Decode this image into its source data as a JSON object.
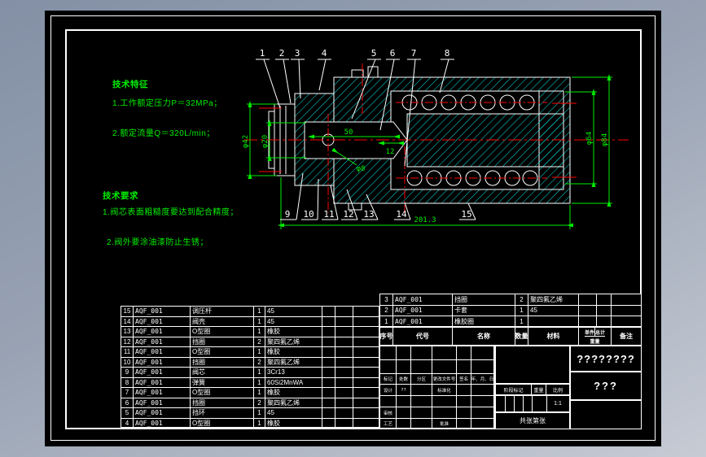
{
  "drawing": {
    "notes": {
      "features_title": "技术特征",
      "features": [
        "1.工作额定压力P＝32MPa；",
        "2.额定流量Q＝320L/min；"
      ],
      "requirements_title": "技术要求",
      "requirements": [
        "1.阀芯表面粗糙度要达到配合精度；",
        "2.阀外要涂油漆防止生锈；"
      ]
    },
    "dims": {
      "phi42": "φ42",
      "phi20": "φ20",
      "len50": "50",
      "len12": "12",
      "phi8": "φ8",
      "len201": "201.3",
      "phi64": "φ64",
      "phi84": "φ84"
    },
    "callouts_top": [
      "1",
      "2",
      "3",
      "4",
      "5",
      "6",
      "7",
      "8"
    ],
    "callouts_bottom": [
      "9",
      "10",
      "11",
      "12",
      "13",
      "14",
      "15"
    ],
    "colors": {
      "outline": "#ffffff",
      "hatch": "#00e5e5",
      "dimension": "#00ee00",
      "centerline": "#ff0000"
    }
  },
  "bom": {
    "headers": {
      "seq": "序号",
      "code": "代号",
      "name": "名称",
      "qty": "数量",
      "material": "材料",
      "unit": "单件",
      "total": "总计",
      "weight": "重量",
      "remark": "备注"
    },
    "left_rows": [
      [
        "15",
        "AQF_001",
        "调压杆",
        "1",
        "45",
        "",
        "",
        ""
      ],
      [
        "14",
        "AQF_001",
        "阀壳",
        "1",
        "45",
        "",
        "",
        ""
      ],
      [
        "13",
        "AQF_001",
        "O型圈",
        "1",
        "橡胶",
        "",
        "",
        ""
      ],
      [
        "12",
        "AQF_001",
        "挡圈",
        "2",
        "聚四氟乙烯",
        "",
        "",
        ""
      ],
      [
        "11",
        "AQF_001",
        "O型圈",
        "1",
        "橡胶",
        "",
        "",
        ""
      ],
      [
        "10",
        "AQF_001",
        "挡圈",
        "2",
        "聚四氟乙烯",
        "",
        "",
        ""
      ],
      [
        "9",
        "AQF_001",
        "阀芯",
        "1",
        "3Cr13",
        "",
        "",
        ""
      ],
      [
        "8",
        "AQF_001",
        "弹簧",
        "1",
        "60Si2MnWA",
        "",
        "",
        ""
      ],
      [
        "7",
        "AQF_001",
        "O型圈",
        "1",
        "橡胶",
        "",
        "",
        ""
      ],
      [
        "6",
        "AQF_001",
        "挡圈",
        "2",
        "聚四氟乙烯",
        "",
        "",
        ""
      ],
      [
        "5",
        "AQF_001",
        "挡环",
        "1",
        "45",
        "",
        "",
        ""
      ],
      [
        "4",
        "AQF_001",
        "O型圈",
        "1",
        "橡胶",
        "",
        "",
        ""
      ]
    ],
    "right_rows": [
      [
        "3",
        "AQF_001",
        "挡圈",
        "2",
        "聚四氟乙烯",
        "",
        "",
        ""
      ],
      [
        "2",
        "AQF_001",
        "卡套",
        "1",
        "45",
        "",
        "",
        ""
      ],
      [
        "1",
        "AQF_001",
        "橡胶圈",
        "1",
        "",
        "",
        "",
        ""
      ]
    ]
  },
  "titleblock": {
    "sig_rows": [
      [
        "",
        "",
        "",
        "",
        "",
        ""
      ],
      [
        "",
        "",
        "",
        "",
        "",
        ""
      ],
      [
        "标记",
        "处数",
        "分区",
        "更改文件号",
        "签名",
        "年、月、日"
      ],
      [
        "设计",
        "??",
        "",
        "标准化",
        "",
        ""
      ],
      [
        "",
        "",
        "",
        "",
        "",
        ""
      ],
      [
        "审核",
        "",
        "",
        "",
        "",
        ""
      ],
      [
        "工艺",
        "",
        "",
        "批准",
        "",
        ""
      ]
    ],
    "stage_label": "阶段标记",
    "weight_label": "重量",
    "scale_label": "比例",
    "scale_value": "1:1",
    "sheets": [
      "共",
      "张",
      "第",
      "张"
    ],
    "title_main": "????????",
    "title_sub": "???"
  }
}
